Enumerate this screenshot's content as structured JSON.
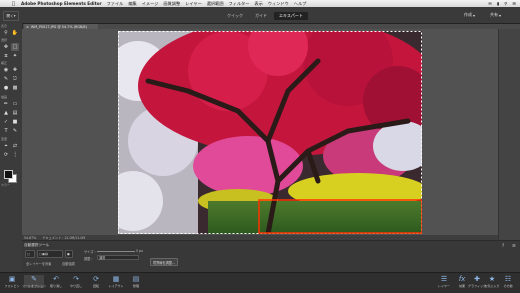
{
  "menubar": {
    "apple": "",
    "app": "Adobe Photoshop Elements Editor",
    "items": [
      "ファイル",
      "編集",
      "イメージ",
      "画質調整",
      "レイヤー",
      "選択範囲",
      "フィルター",
      "表示",
      "ウィンドウ",
      "ヘルプ"
    ]
  },
  "modebar": {
    "open_label": "開く",
    "tabs": [
      "クイック",
      "ガイド",
      "エキスパート"
    ],
    "active_tab": "エキスパート",
    "create_label": "作成",
    "share_label": "共有"
  },
  "toolbox": {
    "sections": [
      "表示",
      "選択",
      "補正",
      "描画",
      "変更",
      "カラー"
    ]
  },
  "document": {
    "tab_title": "WM_P0017.JPG @ 54.7% (RGB/8)"
  },
  "status": {
    "zoom": "54.67%",
    "doc_info": "ドキュメント : 12.0M/12.0M"
  },
  "tool_options": {
    "title": "自動選択ツール",
    "size_label": "サイズ :",
    "size_value": "5 px",
    "mode_label": "調整 :",
    "mode_value": "通常",
    "sample_label": "全レイヤーを対象",
    "autofix_label": "自動強調",
    "refine_label": "境界線を調整...",
    "hint_text": "レイヤー"
  },
  "taskbar": {
    "left": [
      "フォトビン",
      "ツールオプション",
      "取り消し",
      "やり直し",
      "回転",
      "レイアウト",
      "整理"
    ],
    "right": [
      "レイヤー",
      "効果",
      "グラフィック",
      "お気に入り",
      "その他"
    ]
  },
  "colors": {
    "selection_box": "#ff3300",
    "foreground": "#111111",
    "background": "#ffffff"
  }
}
